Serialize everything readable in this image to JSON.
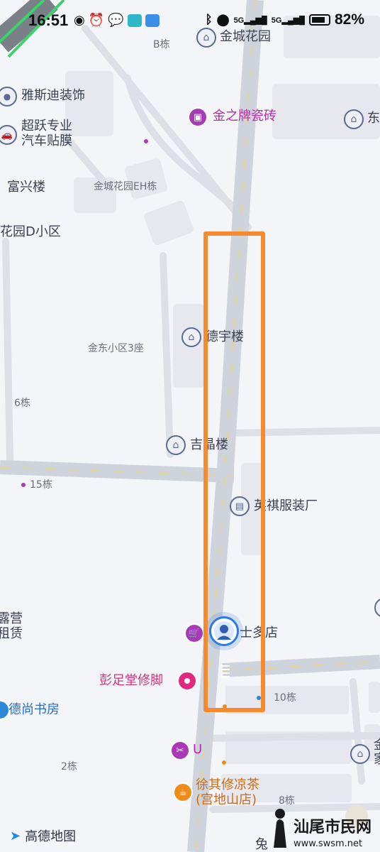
{
  "status_bar": {
    "time": "16:51",
    "battery": "82%",
    "battery_level": 0.82,
    "signal_labels": [
      "5G",
      "5G"
    ],
    "notification_icons": [
      "eye-icon",
      "alarm-icon",
      "wechat-icon",
      "boss-app-icon",
      "shopping-bag-icon"
    ],
    "system_icons": [
      "bluetooth-icon",
      "location-icon",
      "signal-icon",
      "signal-icon",
      "battery-icon"
    ]
  },
  "map": {
    "road_color": "#d9dce4",
    "main_road_color": "#cfd3dc",
    "building_color": "#e6e8ed",
    "highlight_color": "#f58a2f",
    "pois": [
      {
        "id": "jinchenghuayuan",
        "name": "金城花园",
        "icon": "residential-icon",
        "color": "gray"
      },
      {
        "id": "b-dong",
        "name": "B栋",
        "icon": "",
        "color": "small"
      },
      {
        "id": "yasidi",
        "name": "雅斯迪装饰",
        "icon": "building-icon",
        "color": "gray"
      },
      {
        "id": "jinzhipai",
        "name": "金之牌瓷砖",
        "icon": "shop-icon",
        "color": "purple"
      },
      {
        "id": "dong",
        "name": "东",
        "icon": "residential-icon",
        "color": "gray"
      },
      {
        "id": "chaoyue",
        "name": "超跃专业\n汽车贴膜",
        "icon": "car-icon",
        "color": "gray"
      },
      {
        "id": "fuxinglou",
        "name": "富兴楼",
        "icon": "",
        "color": "poi"
      },
      {
        "id": "jinchengeh",
        "name": "金城花园EH栋",
        "icon": "",
        "color": "small"
      },
      {
        "id": "huayuand",
        "name": "花园D小区",
        "icon": "",
        "color": "poi"
      },
      {
        "id": "deyulou",
        "name": "德宇楼",
        "icon": "residential-icon",
        "color": "gray"
      },
      {
        "id": "jindong3",
        "name": "金东小区3座",
        "icon": "",
        "color": "small"
      },
      {
        "id": "6dong",
        "name": "6栋",
        "icon": "",
        "color": "small"
      },
      {
        "id": "jijinglou",
        "name": "吉晶楼",
        "icon": "residential-icon",
        "color": "gray"
      },
      {
        "id": "15dong",
        "name": "15栋",
        "icon": "",
        "color": "small"
      },
      {
        "id": "yingqi",
        "name": "英祺服装厂",
        "icon": "factory-icon",
        "color": "gray"
      },
      {
        "id": "luying",
        "name": "露营\n租赁",
        "icon": "",
        "color": "poi"
      },
      {
        "id": "shiduodian",
        "name": "士多店",
        "icon": "cart-icon",
        "color": "purple"
      },
      {
        "id": "pengzutang",
        "name": "彭足堂修脚",
        "icon": "spa-icon",
        "color": "pink"
      },
      {
        "id": "10dong",
        "name": "10栋",
        "icon": "",
        "color": "small"
      },
      {
        "id": "deshang",
        "name": "德尚书房",
        "icon": "book-icon",
        "color": "blue"
      },
      {
        "id": "u",
        "name": "U",
        "icon": "scissors-icon",
        "color": "purple"
      },
      {
        "id": "jinjia",
        "name": "金\n家",
        "icon": "residential-icon",
        "color": "gray"
      },
      {
        "id": "2dong",
        "name": "2栋",
        "icon": "",
        "color": "small"
      },
      {
        "id": "xuqixiu",
        "name": "徐其修凉茶\n(宫地山店)",
        "icon": "tea-icon",
        "color": "orange"
      },
      {
        "id": "8dong",
        "name": "8栋",
        "icon": "",
        "color": "small"
      },
      {
        "id": "tu",
        "name": "兔",
        "icon": "",
        "color": "poi"
      }
    ]
  },
  "footer": {
    "app_logo": "高德地图",
    "watermark_text": "汕尾市民网",
    "watermark_url": "www.swsm.net"
  }
}
